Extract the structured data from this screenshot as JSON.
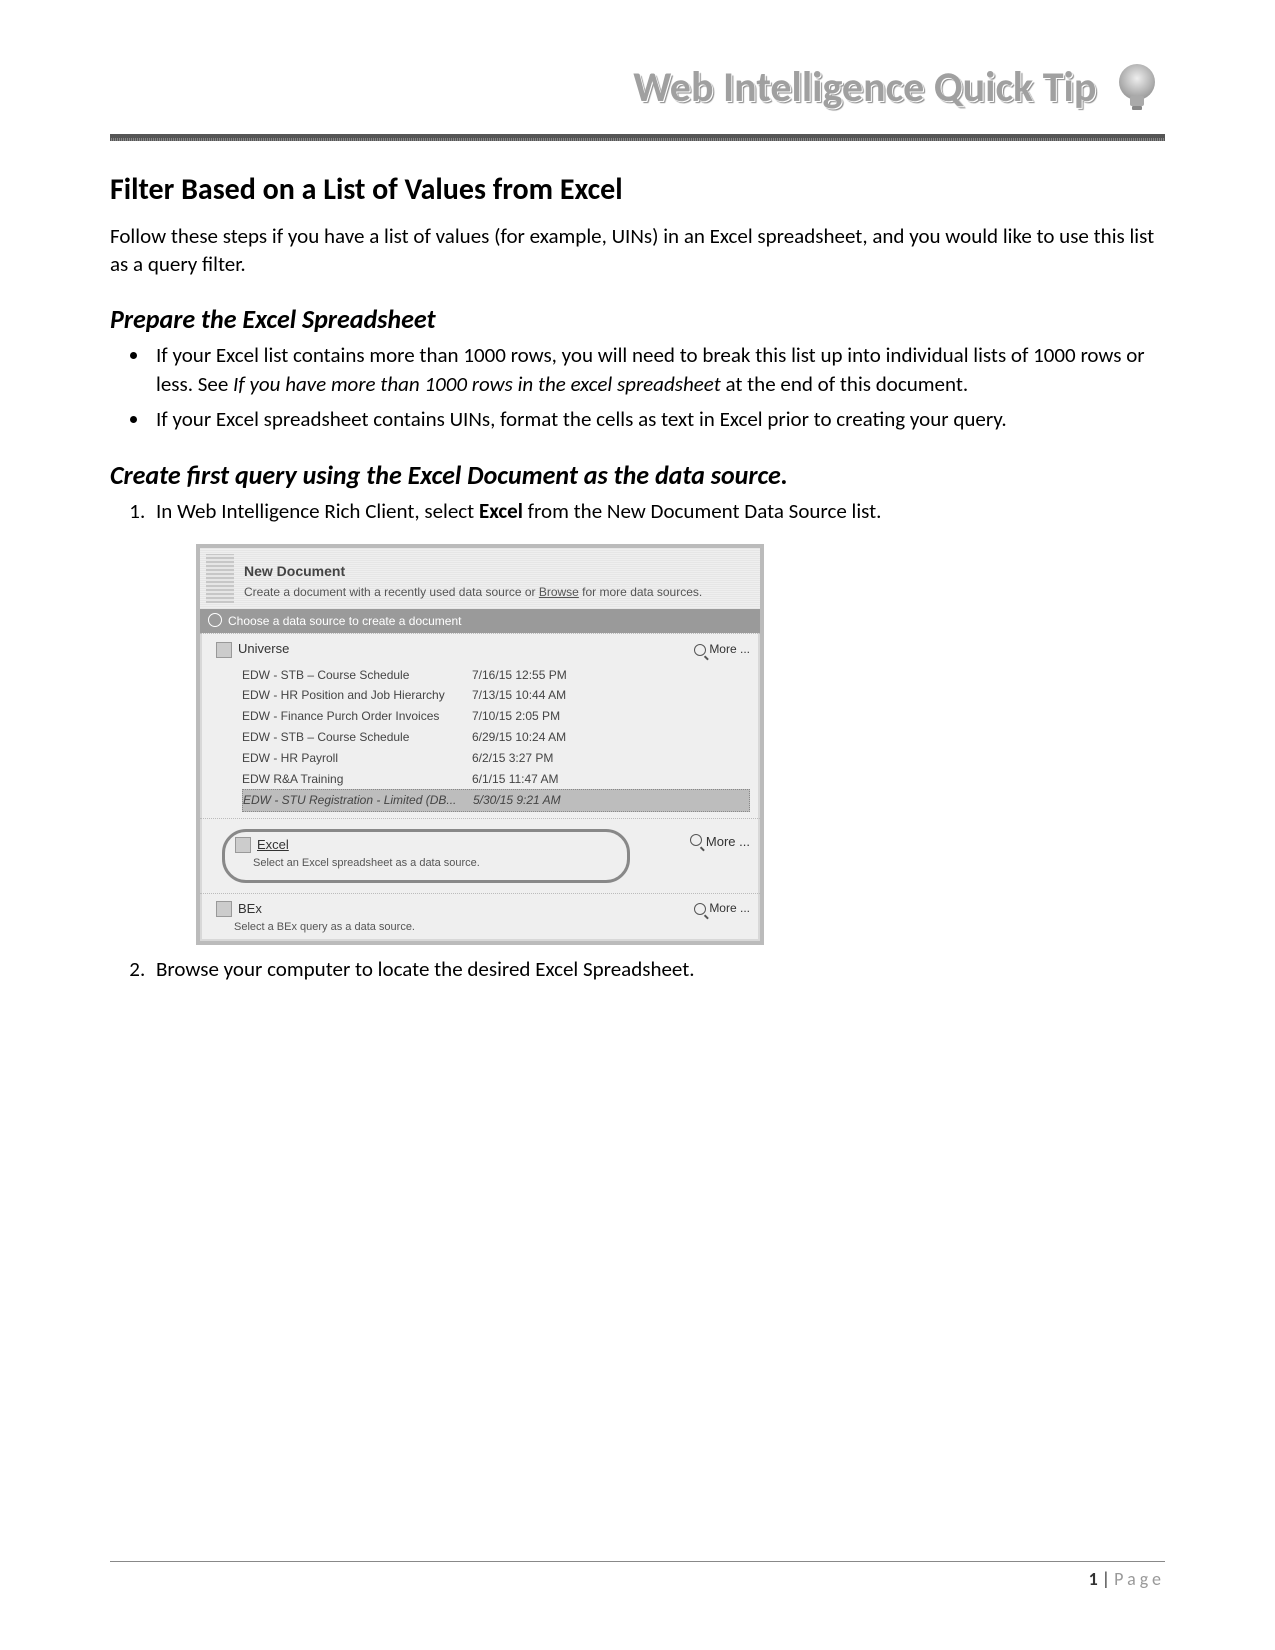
{
  "header": {
    "title": "Web Intelligence Quick Tip"
  },
  "doc": {
    "title": "Filter Based on a List of Values from Excel",
    "intro": "Follow these steps if you have a list of values (for example, UINs) in an Excel spreadsheet, and you would like to use this list as a query filter.",
    "section1_heading": "Prepare the Excel Spreadsheet",
    "bullet1_a": "If your Excel list contains more than 1000 rows, you will need to break this list up into individual lists of 1000 rows or less. See ",
    "bullet1_b_italic": "If you have more than 1000 rows in the excel spreadsheet",
    "bullet1_c": " at the end of this document.",
    "bullet2": "If your Excel spreadsheet contains UINs, format the cells as text in Excel prior to creating your query.",
    "section2_heading": "Create first query using the Excel Document as the data source.",
    "step1_a": "In Web Intelligence Rich Client, select ",
    "step1_b_bold": "Excel",
    "step1_c": " from the New Document Data Source list.",
    "step2": "Browse your computer to locate the desired Excel Spreadsheet."
  },
  "panel": {
    "new_document": "New Document",
    "new_document_sub_a": "Create a document with a recently used data source or ",
    "new_document_sub_link": "Browse",
    "new_document_sub_b": " for more data sources.",
    "choose_label": "Choose a data source to create a document",
    "universe_label": "Universe",
    "more_label": "More ...",
    "universe_rows": [
      {
        "name": "EDW - STB – Course Schedule",
        "date": "7/16/15 12:55 PM"
      },
      {
        "name": "EDW - HR Position and Job Hierarchy",
        "date": "7/13/15 10:44 AM"
      },
      {
        "name": "EDW - Finance Purch Order Invoices",
        "date": "7/10/15 2:05 PM"
      },
      {
        "name": "EDW - STB – Course Schedule",
        "date": "6/29/15 10:24 AM"
      },
      {
        "name": "EDW - HR Payroll",
        "date": "6/2/15 3:27 PM"
      },
      {
        "name": "EDW R&A Training",
        "date": "6/1/15 11:47 AM"
      }
    ],
    "universe_selected": {
      "name": "EDW - STU Registration - Limited (DB...",
      "date": "5/30/15 9:21 AM"
    },
    "excel_label": "Excel",
    "excel_sub": "Select an Excel spreadsheet as a data source.",
    "bex_label": "BEx",
    "bex_sub": "Select a BEx query as a data source."
  },
  "footer": {
    "page_number": "1",
    "sep": " | ",
    "page_word": "Page"
  }
}
